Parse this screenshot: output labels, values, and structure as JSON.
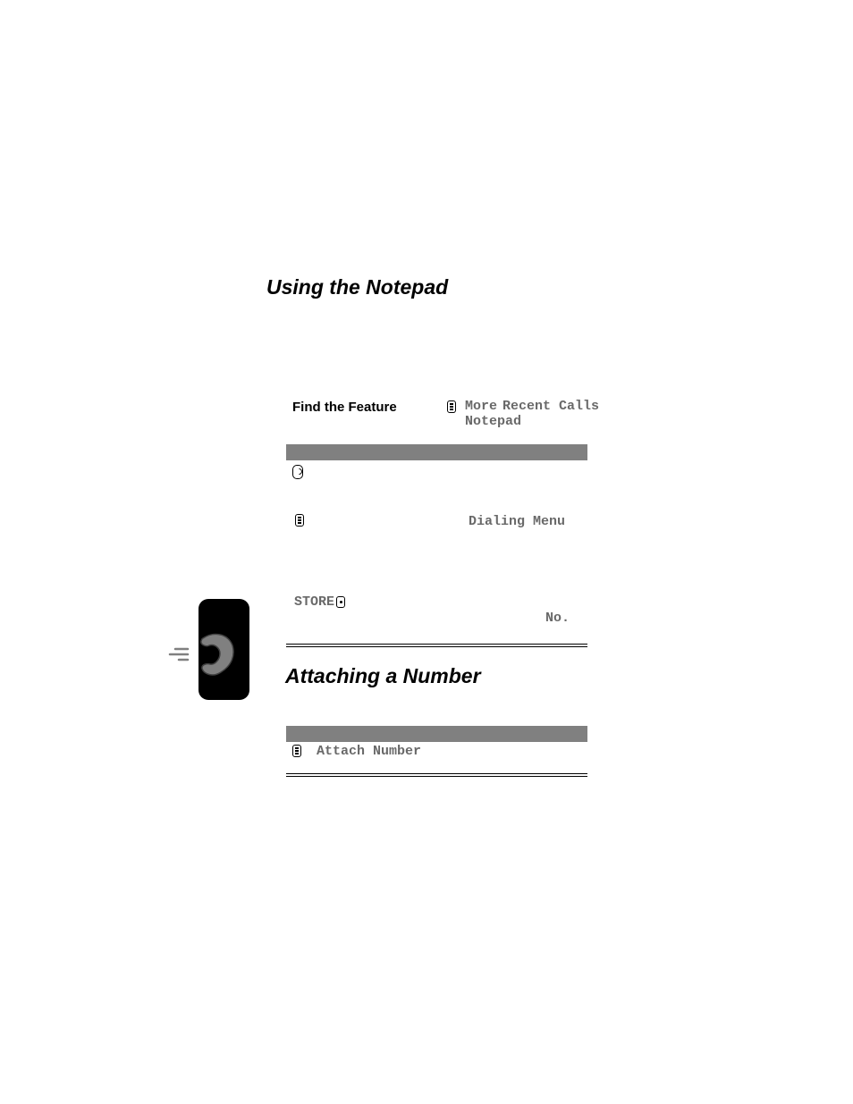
{
  "sections": {
    "heading1": "Using the Notepad",
    "heading2": "Attaching a Number"
  },
  "findFeature": {
    "label": "Find the Feature",
    "pathMore": "More",
    "pathRecent": "Recent Calls",
    "pathNotepad": "Notepad"
  },
  "rows": {
    "dialingMenu": "Dialing Menu",
    "store": "STORE",
    "no": "No.",
    "attachNumber": "Attach Number"
  }
}
